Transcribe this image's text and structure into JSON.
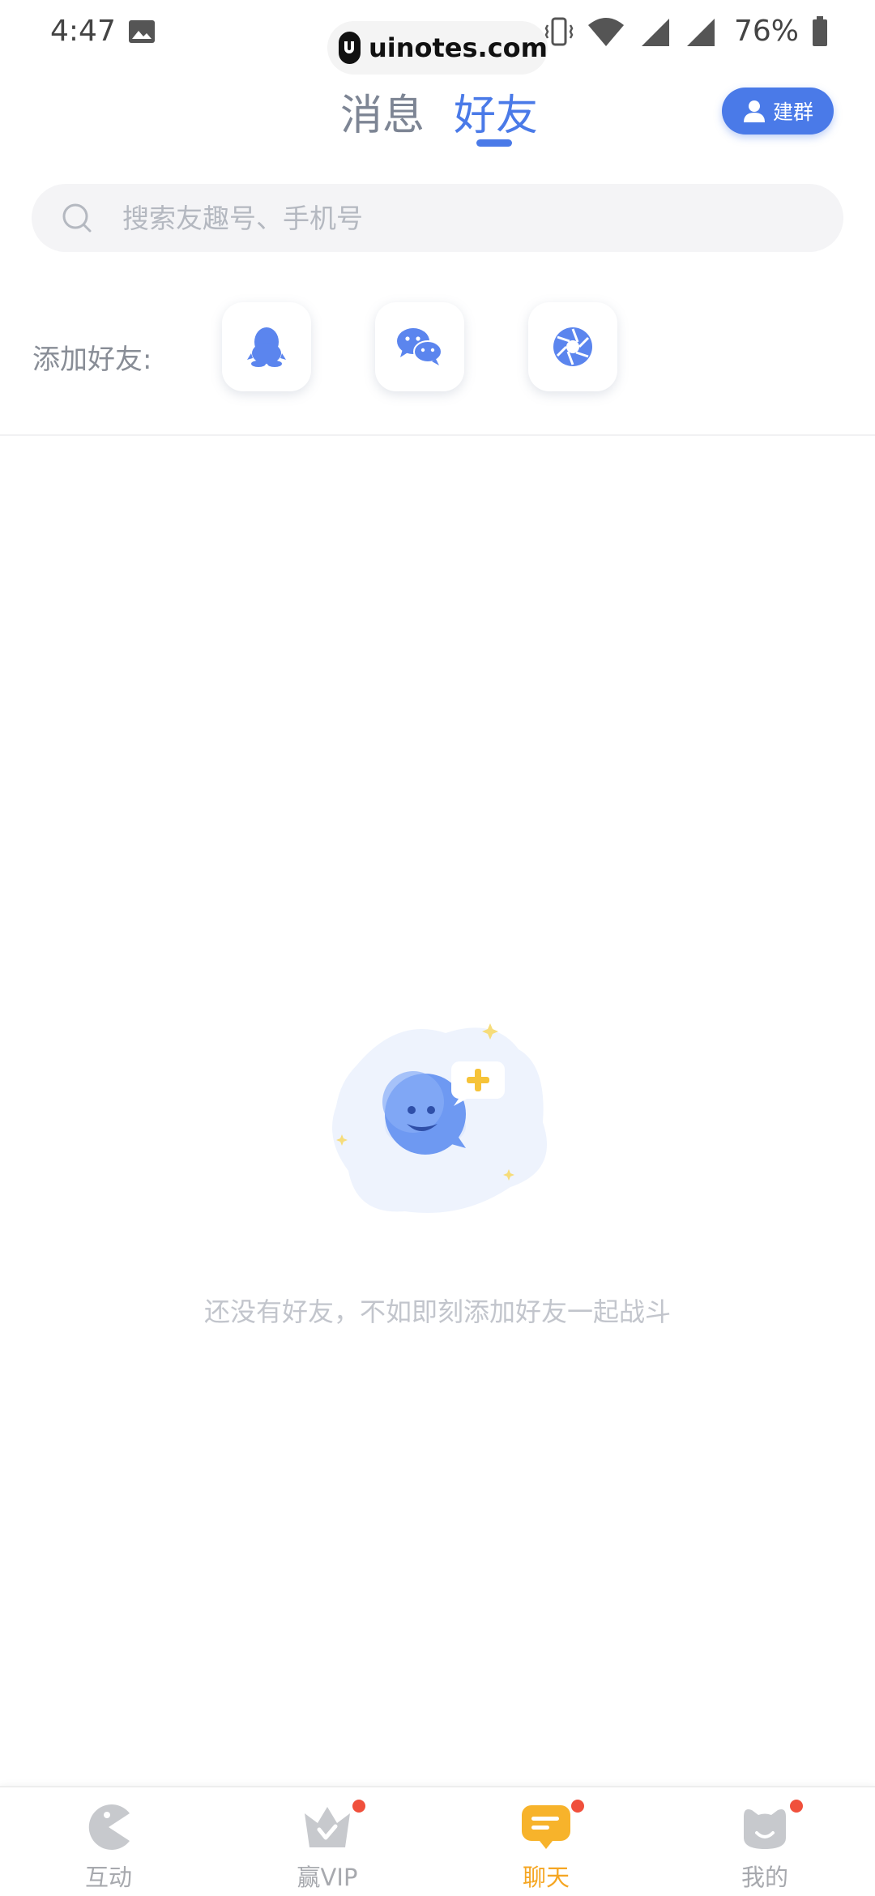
{
  "status_bar": {
    "time": "4:47",
    "battery": "76%",
    "watermark": "uinotes.com"
  },
  "header": {
    "tab_messages": "消息",
    "tab_friends": "好友",
    "active_tab": "好友",
    "group_button": "建群",
    "accent_color": "#4a7ae8"
  },
  "search": {
    "placeholder": "搜索友趣号、手机号",
    "value": ""
  },
  "add_friends": {
    "label": "添加好友:",
    "options": [
      {
        "icon": "qq-icon"
      },
      {
        "icon": "wechat-icon"
      },
      {
        "icon": "camera-shutter-icon"
      }
    ]
  },
  "empty_state": {
    "message": "还没有好友，不如即刻添加好友一起战斗",
    "icon": "smiley-chat-bubble-plus-illustration"
  },
  "bottom_nav": {
    "items": [
      {
        "label": "互动",
        "icon": "pacman-icon",
        "badge": false
      },
      {
        "label": "赢VIP",
        "icon": "crown-icon",
        "badge": true
      },
      {
        "label": "聊天",
        "icon": "chat-icon",
        "badge": true,
        "active": true
      },
      {
        "label": "我的",
        "icon": "cat-face-icon",
        "badge": true
      }
    ],
    "active_color": "#f5a623",
    "badge_color": "#f0503c"
  }
}
